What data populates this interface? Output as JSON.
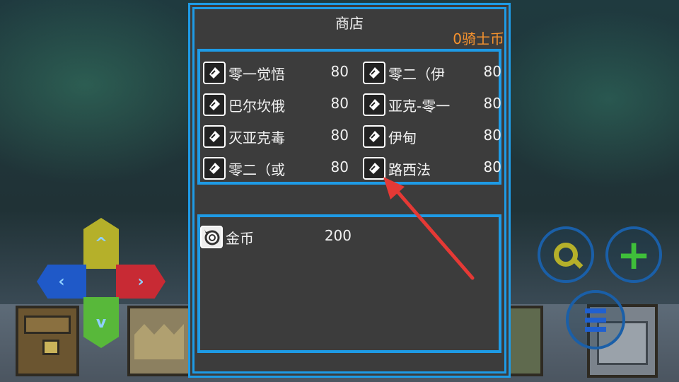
{
  "shop": {
    "title": "商店",
    "currency": "0骑士币",
    "items": [
      {
        "name": "零一觉悟",
        "price": "80"
      },
      {
        "name": "零二（伊",
        "price": "80"
      },
      {
        "name": "巴尔坎俄",
        "price": "80"
      },
      {
        "name": "亚克-零一",
        "price": "80"
      },
      {
        "name": "灭亚克毒",
        "price": "80"
      },
      {
        "name": "伊甸",
        "price": "80"
      },
      {
        "name": "零二（或",
        "price": "80"
      },
      {
        "name": "路西法",
        "price": "80"
      }
    ]
  },
  "inventory": {
    "items": [
      {
        "name": "金币",
        "amount": "200",
        "icon": "coin-icon"
      }
    ]
  },
  "colors": {
    "panel_border": "#1e9be6",
    "panel_bg": "#3c3c3c",
    "currency": "#f5922e",
    "arrow": "#e53935"
  }
}
